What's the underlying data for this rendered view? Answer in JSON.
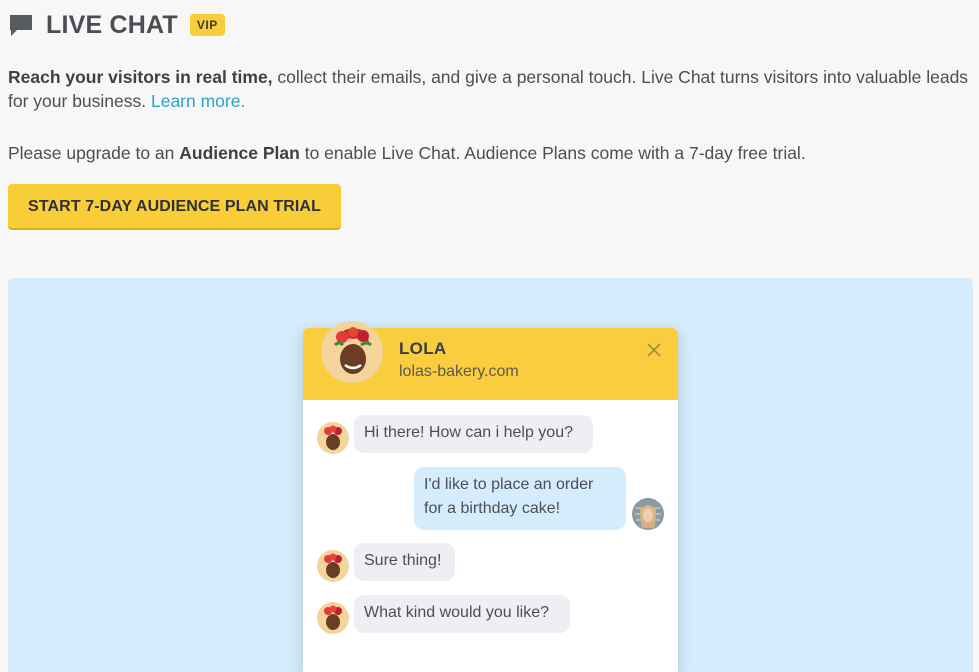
{
  "header": {
    "title": "LIVE CHAT",
    "badge": "VIP",
    "icon": "chat-bubble-icon"
  },
  "intro": {
    "bold": "Reach your visitors in real time,",
    "rest": " collect their emails, and give a personal touch. Live Chat turns visitors into valuable leads for your business. ",
    "link": "Learn more."
  },
  "upgrade": {
    "pre": "Please upgrade to an ",
    "bold": "Audience Plan",
    "post": " to enable Live Chat. Audience Plans come with a 7-day free trial."
  },
  "cta": {
    "label": "START 7-DAY AUDIENCE PLAN TRIAL"
  },
  "widget": {
    "name": "LOLA",
    "site": "lolas-bakery.com",
    "messages": [
      {
        "from": "agent",
        "text": "Hi there! How can i help you?"
      },
      {
        "from": "visitor",
        "text": "I'd like to place an order for a birthday cake!"
      },
      {
        "from": "agent",
        "text": "Sure thing!"
      },
      {
        "from": "agent",
        "text": "What kind would you like?"
      }
    ]
  },
  "colors": {
    "accent": "#f8cd38",
    "link": "#2aa3c8",
    "preview_bg": "#d4ecfb",
    "bubble_in": "#eeeff4"
  }
}
